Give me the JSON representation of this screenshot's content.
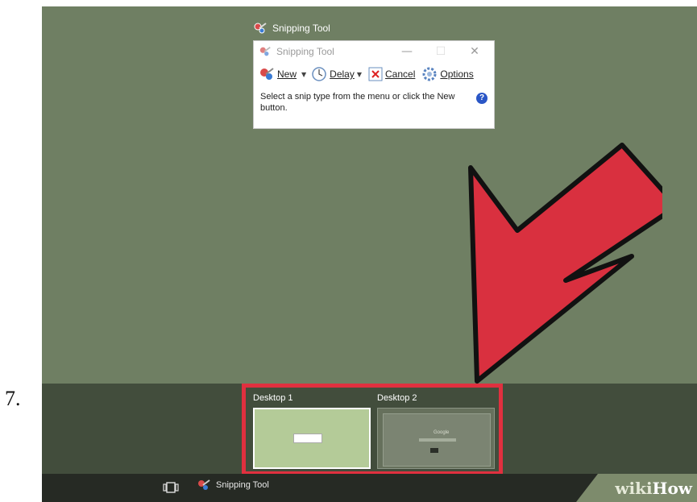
{
  "step": {
    "number": "7."
  },
  "float_title": {
    "text": "Snipping Tool"
  },
  "window": {
    "title": "Snipping Tool",
    "controls": {
      "minimize": "—",
      "maximize": "☐",
      "close": "✕"
    },
    "toolbar": {
      "new_label": "New",
      "delay_label": "Delay",
      "cancel_label": "Cancel",
      "options_label": "Options"
    },
    "message": "Select a snip type from the menu or click the New button.",
    "help": "?"
  },
  "taskview": {
    "desktops": [
      {
        "label": "Desktop 1"
      },
      {
        "label": "Desktop 2"
      }
    ],
    "desktop2_preview_text": "Google"
  },
  "taskbar": {
    "app_label": "Snipping Tool"
  },
  "watermark": {
    "wiki": "wiki",
    "how": "How"
  },
  "colors": {
    "desktop_bg": "#6f7f63",
    "highlight": "#e0303f",
    "arrow": "#d9303f"
  }
}
